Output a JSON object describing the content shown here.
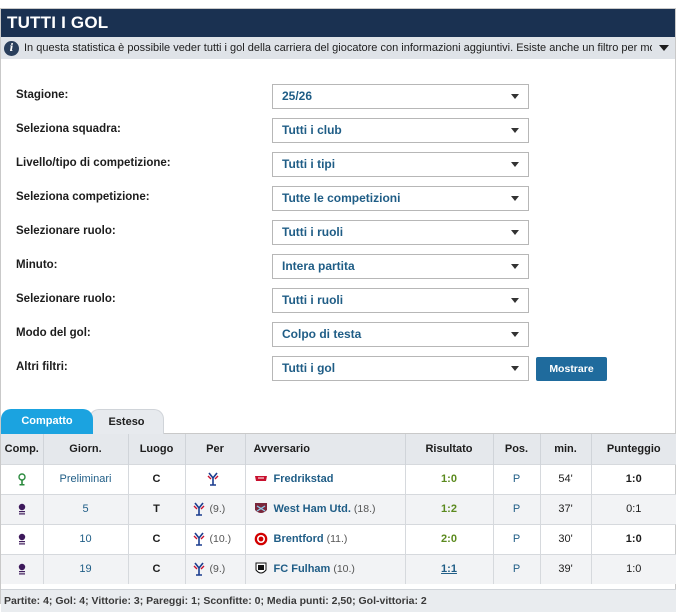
{
  "header": {
    "title": "TUTTI I GOL"
  },
  "info": {
    "text": "In questa statistica è possibile veder tutti i gol della carriera del giocatore con informazioni aggiuntivi. Esiste anche un filtro per mostrare l'ele..."
  },
  "filters": [
    {
      "label": "Stagione:",
      "value": "25/26"
    },
    {
      "label": "Seleziona squadra:",
      "value": "Tutti i club"
    },
    {
      "label": "Livello/tipo di competizione:",
      "value": "Tutti i tipi"
    },
    {
      "label": "Seleziona competizione:",
      "value": "Tutte le competizioni"
    },
    {
      "label": "Selezionare ruolo:",
      "value": "Tutti i ruoli"
    },
    {
      "label": "Minuto:",
      "value": "Intera partita"
    },
    {
      "label": "Selezionare ruolo:",
      "value": "Tutti i ruoli"
    },
    {
      "label": "Modo del gol:",
      "value": "Colpo di testa"
    },
    {
      "label": "Altri filtri:",
      "value": "Tutti i gol"
    }
  ],
  "show_button": "Mostrare",
  "tabs": {
    "active": "Compatto",
    "inactive": "Esteso"
  },
  "table": {
    "headers": [
      "Comp.",
      "Giorn.",
      "Luogo",
      "Per",
      "Avversario",
      "Risultato",
      "Pos.",
      "min.",
      "Punteggio"
    ],
    "rows": [
      {
        "comp_icon": "conference-league-icon",
        "giorn": "Preliminari",
        "luogo": "C",
        "per_rank": "",
        "opponent": "Fredrikstad",
        "opp_rank": "",
        "result": "1:0",
        "pos": "P",
        "min": "54'",
        "score": "1:0"
      },
      {
        "comp_icon": "premier-league-icon",
        "giorn": "5",
        "luogo": "T",
        "per_rank": "(9.)",
        "opponent": "West Ham Utd.",
        "opp_rank": "(18.)",
        "result": "1:2",
        "pos": "P",
        "min": "37'",
        "score": "0:1"
      },
      {
        "comp_icon": "premier-league-icon",
        "giorn": "10",
        "luogo": "C",
        "per_rank": "(10.)",
        "opponent": "Brentford",
        "opp_rank": "(11.)",
        "result": "2:0",
        "pos": "P",
        "min": "30'",
        "score": "1:0"
      },
      {
        "comp_icon": "premier-league-icon",
        "giorn": "19",
        "luogo": "C",
        "per_rank": "(9.)",
        "opponent": "FC Fulham",
        "opp_rank": "(10.)",
        "result": "1:1",
        "pos": "P",
        "min": "39'",
        "score": "1:0"
      }
    ]
  },
  "footer": "Partite: 4; Gol: 4; Vittorie: 3; Pareggi: 1; Sconfitte: 0; Media punti: 2,50; Gol-vittoria: 2",
  "colors": {
    "header_bg": "#1a3151",
    "accent": "#1ba3e0",
    "link": "#1f5d86",
    "button": "#1f6b9d",
    "win_result": "#5b8a1e"
  }
}
